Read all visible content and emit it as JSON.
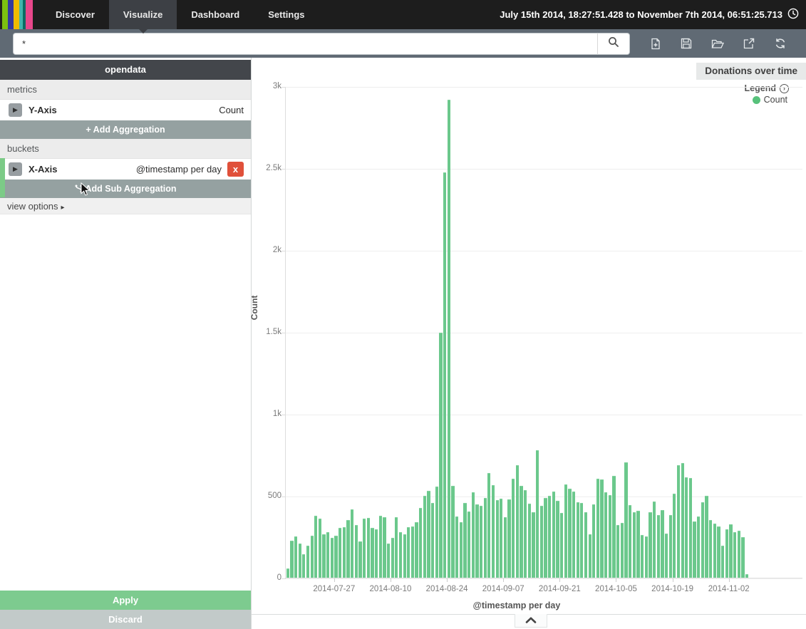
{
  "nav": {
    "logo_colors": [
      "#23231c",
      "#7cc110",
      "#333a9e",
      "#efbc00",
      "#41b5ac",
      "#0c6b63",
      "#e8478b"
    ],
    "tabs": [
      {
        "label": "Discover",
        "active": false
      },
      {
        "label": "Visualize",
        "active": true
      },
      {
        "label": "Dashboard",
        "active": false
      },
      {
        "label": "Settings",
        "active": false
      }
    ],
    "time_range": "July 15th 2014, 18:27:51.428 to November 7th 2014, 06:51:25.713"
  },
  "toolbar": {
    "query_value": "*",
    "icons": [
      "search",
      "new-document",
      "save",
      "open-folder",
      "share-export",
      "refresh"
    ]
  },
  "sidebar": {
    "index_title": "opendata",
    "metrics_label": "metrics",
    "buckets_label": "buckets",
    "y_axis": {
      "label": "Y-Axis",
      "value": "Count"
    },
    "x_axis": {
      "label": "X-Axis",
      "value": "@timestamp per day"
    },
    "add_aggregation_label": "+ Add Aggregation",
    "add_sub_aggregation_label": "Add Sub Aggregation",
    "view_options_label": "view options",
    "view_options_caret": "▸",
    "apply_label": "Apply",
    "discard_label": "Discard",
    "delete_x_label": "x",
    "caret_glyph": "▶"
  },
  "chart": {
    "title": "Donations over time",
    "legend_label": "Legend",
    "legend_toggle_glyph": "›",
    "legend_items": [
      {
        "label": "Count",
        "color": "#57c17b"
      }
    ]
  },
  "chart_data": {
    "type": "bar",
    "title": "Donations over time",
    "xlabel": "@timestamp per day",
    "ylabel": "Count",
    "ylim": [
      0,
      3000
    ],
    "grid": true,
    "legend_position": "top-right",
    "bar_color": "#6bc88c",
    "y_tick_values": [
      0,
      500,
      1000,
      1500,
      2000,
      2500,
      3000
    ],
    "y_tick_labels": [
      "0",
      "500",
      "1k",
      "1.5k",
      "2k",
      "2.5k",
      "3k"
    ],
    "x_start_date": "2014-07-15",
    "x_interval": "1 day",
    "x_tick_marks": [
      {
        "index": 12,
        "label": "2014-07-27"
      },
      {
        "index": 26,
        "label": "2014-08-10"
      },
      {
        "index": 40,
        "label": "2014-08-24"
      },
      {
        "index": 54,
        "label": "2014-09-07"
      },
      {
        "index": 68,
        "label": "2014-09-21"
      },
      {
        "index": 82,
        "label": "2014-10-05"
      },
      {
        "index": 96,
        "label": "2014-10-19"
      },
      {
        "index": 110,
        "label": "2014-11-02"
      }
    ],
    "series": [
      {
        "name": "Count",
        "values": [
          60,
          230,
          255,
          215,
          150,
          200,
          260,
          385,
          365,
          270,
          285,
          250,
          260,
          310,
          315,
          355,
          420,
          325,
          225,
          365,
          370,
          310,
          300,
          385,
          375,
          215,
          250,
          375,
          283,
          270,
          312,
          317,
          345,
          432,
          504,
          535,
          462,
          559,
          1500,
          2480,
          2920,
          565,
          378,
          345,
          461,
          408,
          527,
          452,
          443,
          491,
          643,
          570,
          478,
          487,
          374,
          483,
          609,
          691,
          565,
          539,
          457,
          404,
          783,
          443,
          491,
          504,
          530,
          474,
          400,
          574,
          548,
          530,
          465,
          461,
          404,
          270,
          452,
          609,
          604,
          527,
          509,
          626,
          326,
          339,
          709,
          448,
          404,
          413,
          265,
          257,
          404,
          470,
          387,
          417,
          274,
          387,
          517,
          691,
          704,
          617,
          613,
          348,
          378,
          465,
          504,
          357,
          335,
          317,
          200,
          300,
          330,
          283,
          291,
          252,
          25
        ]
      }
    ]
  }
}
